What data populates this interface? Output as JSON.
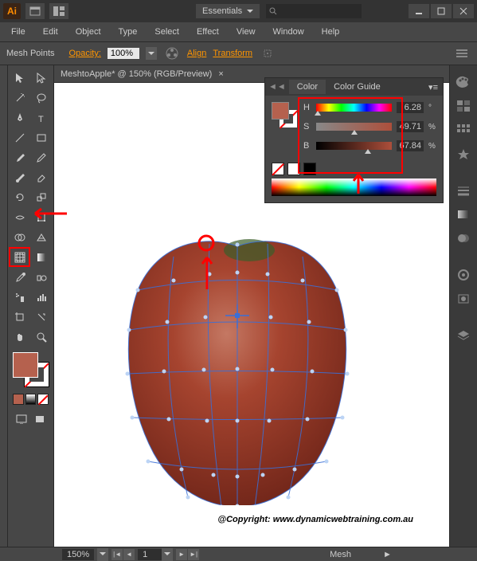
{
  "titlebar": {
    "logo": "Ai",
    "workspace": "Essentials"
  },
  "menubar": [
    "File",
    "Edit",
    "Object",
    "Type",
    "Select",
    "Effect",
    "View",
    "Window",
    "Help"
  ],
  "control_bar": {
    "label": "Mesh Points",
    "opacity_label": "Opacity:",
    "opacity_value": "100%",
    "links": [
      "Align",
      "Transform"
    ]
  },
  "document": {
    "tab_title": "MeshtoApple* @ 150% (RGB/Preview)"
  },
  "color_panel": {
    "tabs": [
      "Color",
      "Color Guide"
    ],
    "channels": {
      "h": {
        "label": "H",
        "value": "6.28",
        "unit": "°",
        "pos": 2
      },
      "s": {
        "label": "S",
        "value": "49.71",
        "unit": "%",
        "pos": 50
      },
      "b": {
        "label": "B",
        "value": "67.84",
        "unit": "%",
        "pos": 68
      }
    }
  },
  "statusbar": {
    "zoom": "150%",
    "page": "1",
    "tool": "Mesh"
  },
  "copyright": "@Copyright: www.dynamicwebtraining.com.au",
  "colors": {
    "fill": "#b5614e",
    "apple_dark": "#7a2e1f",
    "apple_light": "#c96a52"
  }
}
